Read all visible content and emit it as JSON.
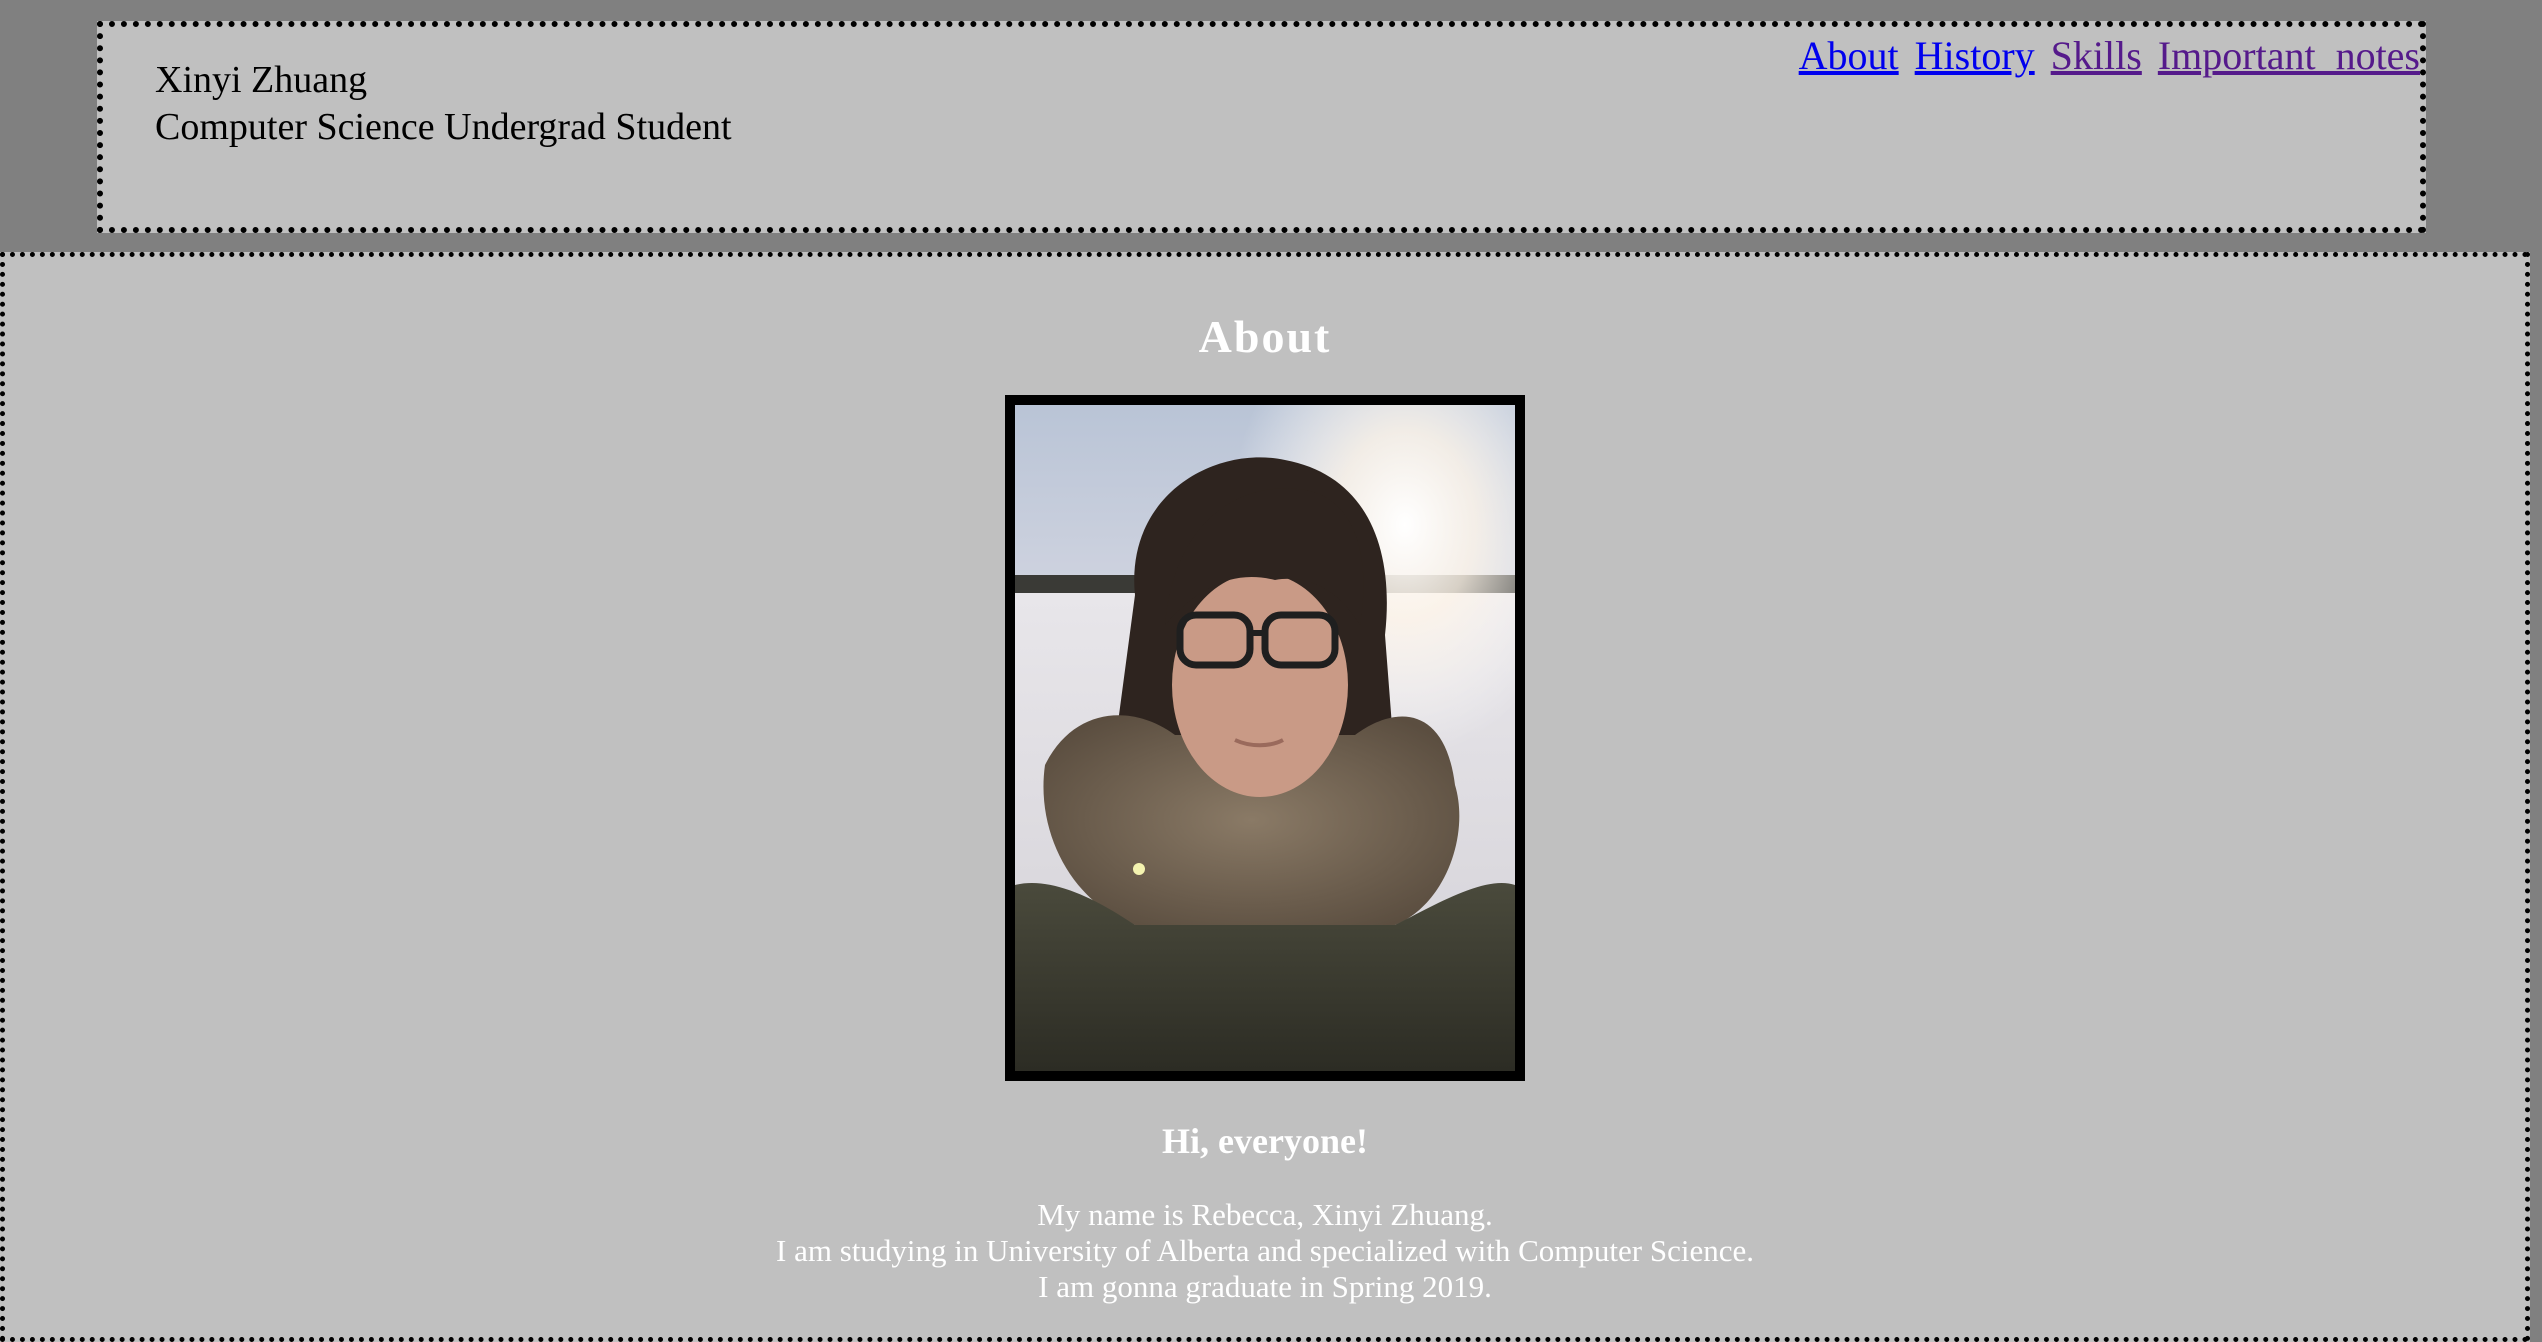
{
  "header": {
    "name": "Xinyi Zhuang",
    "subtitle": "Computer Science Undergrad Student"
  },
  "nav": {
    "items": [
      {
        "label": "About",
        "state": "unvisited"
      },
      {
        "label": "History",
        "state": "unvisited"
      },
      {
        "label": "Skills",
        "state": "visited"
      },
      {
        "label": "Important_notes",
        "state": "visited"
      }
    ]
  },
  "about": {
    "title": "About",
    "greeting": "Hi, everyone!",
    "bio": [
      "My name is Rebecca, Xinyi Zhuang.",
      "I am studying in University of Alberta and specialized with Computer Science.",
      "I am gonna graduate in Spring 2019."
    ]
  },
  "colors": {
    "page_background": "#808080",
    "panel_background": "#c0c0c0",
    "link_unvisited": "#0000ee",
    "link_visited": "#551a8b",
    "main_text": "#ffffff"
  }
}
